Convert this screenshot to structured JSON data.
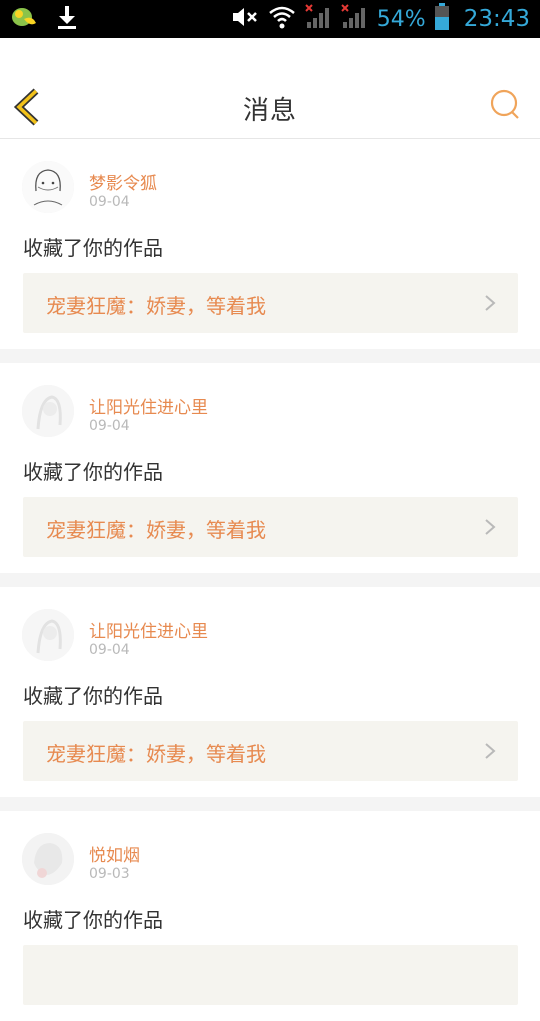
{
  "status_bar": {
    "battery_percent": "54%",
    "time": "23:43",
    "icons": [
      "app-icon",
      "download-icon",
      "mute-icon",
      "wifi-icon",
      "signal-icon",
      "signal-icon-2",
      "battery-icon"
    ],
    "accent": "#35a9d9"
  },
  "header": {
    "title": "消息",
    "back_icon": "chevron-left-icon",
    "search_icon": "search-icon",
    "accent": "#e8a030"
  },
  "messages": [
    {
      "user": "梦影令狐",
      "date": "09-04",
      "action": "收藏了你的作品",
      "work": "宠妻狂魔：娇妻，等着我"
    },
    {
      "user": "让阳光住进心里",
      "date": "09-04",
      "action": "收藏了你的作品",
      "work": "宠妻狂魔：娇妻，等着我"
    },
    {
      "user": "让阳光住进心里",
      "date": "09-04",
      "action": "收藏了你的作品",
      "work": "宠妻狂魔：娇妻，等着我"
    },
    {
      "user": "悦如烟",
      "date": "09-03",
      "action": "收藏了你的作品",
      "work": ""
    }
  ],
  "colors": {
    "name": "#e78a50",
    "work_bg": "#f5f4ef",
    "divider": "#f4f4f4"
  }
}
